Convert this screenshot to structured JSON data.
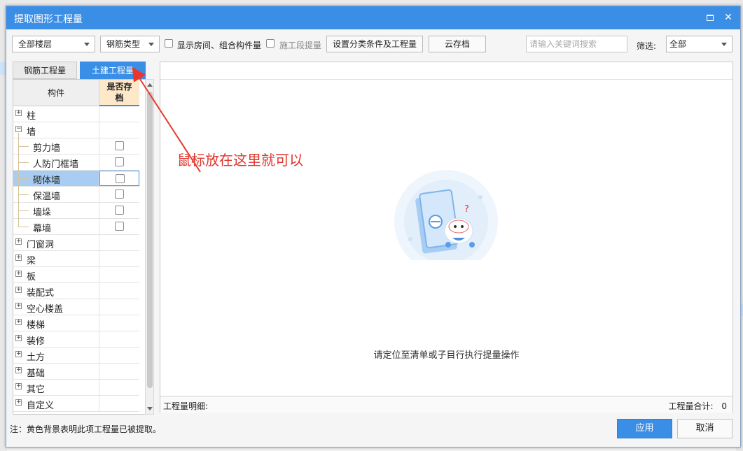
{
  "dialog": {
    "title": "提取图形工程量",
    "maximize_icon": "maximize-icon",
    "close_glyph": "✕"
  },
  "toolbar": {
    "floor_select": "全部楼层",
    "rebar_type_select": "钢筋类型",
    "show_rooms_label": "显示房间、组合构件量",
    "construction_stage_label": "施工段提量",
    "set_conditions_button": "设置分类条件及工程量",
    "cloud_archive_button": "云存档",
    "search_placeholder": "请输入关键词搜索",
    "filter_label": "筛选:",
    "filter_select": "全部"
  },
  "tabs": [
    {
      "label": "钢筋工程量",
      "active": false
    },
    {
      "label": "土建工程量",
      "active": true
    }
  ],
  "tree": {
    "col_component": "构件",
    "col_archive_line1": "是否存",
    "col_archive_line2": "档",
    "rows": [
      {
        "label": "柱",
        "level": 0,
        "expander": "+"
      },
      {
        "label": "墙",
        "level": 0,
        "expander": "−"
      },
      {
        "label": "剪力墙",
        "level": 1,
        "checkbox": true
      },
      {
        "label": "人防门框墙",
        "level": 1,
        "checkbox": true
      },
      {
        "label": "砌体墙",
        "level": 1,
        "checkbox": true,
        "selected": true
      },
      {
        "label": "保温墙",
        "level": 1,
        "checkbox": true
      },
      {
        "label": "墙垛",
        "level": 1,
        "checkbox": true
      },
      {
        "label": "幕墙",
        "level": 1,
        "checkbox": true
      },
      {
        "label": "门窗洞",
        "level": 0,
        "expander": "+"
      },
      {
        "label": "梁",
        "level": 0,
        "expander": "+"
      },
      {
        "label": "板",
        "level": 0,
        "expander": "+"
      },
      {
        "label": "装配式",
        "level": 0,
        "expander": "+"
      },
      {
        "label": "空心楼盖",
        "level": 0,
        "expander": "+"
      },
      {
        "label": "楼梯",
        "level": 0,
        "expander": "+"
      },
      {
        "label": "装修",
        "level": 0,
        "expander": "+"
      },
      {
        "label": "土方",
        "level": 0,
        "expander": "+"
      },
      {
        "label": "基础",
        "level": 0,
        "expander": "+"
      },
      {
        "label": "其它",
        "level": 0,
        "expander": "+"
      },
      {
        "label": "自定义",
        "level": 0,
        "expander": "+"
      }
    ]
  },
  "panel": {
    "empty_message": "请定位至清单或子目行执行提量操作",
    "detail_label": "工程量明细:",
    "total_label": "工程量合计:",
    "total_value": "0"
  },
  "footer": {
    "note": "注：黄色背景表明此项工程量已被提取。",
    "apply_button": "应用",
    "cancel_button": "取消"
  },
  "annotation": {
    "text": "鼠标放在这里就可以",
    "color": "#e0332b"
  },
  "colors": {
    "accent": "#3a8ee6",
    "header_highlight": "#fde8c9",
    "selected_row": "#a9cdf2"
  }
}
